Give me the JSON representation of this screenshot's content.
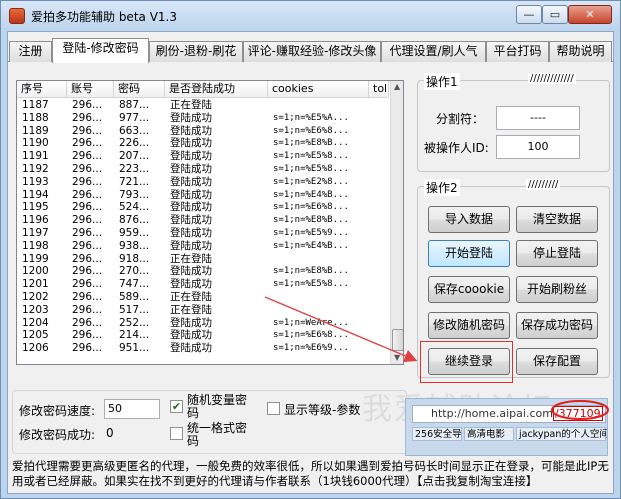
{
  "window": {
    "title": "爱拍多功能辅助 beta V1.3",
    "controls": {
      "minimize": "—",
      "maximize": "▭",
      "close": "✕"
    }
  },
  "tabs": [
    {
      "label": "注册"
    },
    {
      "label": "登陆-修改密码"
    },
    {
      "label": "刷份-退粉-刷花"
    },
    {
      "label": "评论-赚取经验-修改头像"
    },
    {
      "label": "代理设置/刷人气"
    },
    {
      "label": "平台打码"
    },
    {
      "label": "帮助说明"
    }
  ],
  "grid": {
    "columns": [
      "序号",
      "账号",
      "密码",
      "是否登陆成功",
      "cookies",
      "tol"
    ],
    "rows": [
      {
        "id": "1187",
        "acct": "296...",
        "pwd": "887...",
        "status": "正在登陆",
        "cookie": ""
      },
      {
        "id": "1188",
        "acct": "296...",
        "pwd": "977...",
        "status": "登陆成功",
        "cookie": "s=1;n=%E5%A..."
      },
      {
        "id": "1189",
        "acct": "296...",
        "pwd": "663...",
        "status": "登陆成功",
        "cookie": "s=1;n=%E6%8..."
      },
      {
        "id": "1190",
        "acct": "296...",
        "pwd": "226...",
        "status": "登陆成功",
        "cookie": "s=1;n=%E8%B..."
      },
      {
        "id": "1191",
        "acct": "296...",
        "pwd": "207...",
        "status": "登陆成功",
        "cookie": "s=1;n=%E5%8..."
      },
      {
        "id": "1192",
        "acct": "296...",
        "pwd": "223...",
        "status": "登陆成功",
        "cookie": "s=1;n=%E5%8..."
      },
      {
        "id": "1193",
        "acct": "296...",
        "pwd": "721...",
        "status": "登陆成功",
        "cookie": "s=1;n=%E2%8..."
      },
      {
        "id": "1194",
        "acct": "296...",
        "pwd": "793...",
        "status": "登陆成功",
        "cookie": "s=1;n=%E4%B..."
      },
      {
        "id": "1195",
        "acct": "296...",
        "pwd": "524...",
        "status": "登陆成功",
        "cookie": "s=1;n=%E6%8..."
      },
      {
        "id": "1196",
        "acct": "296...",
        "pwd": "876...",
        "status": "登陆成功",
        "cookie": "s=1;n=%E8%B..."
      },
      {
        "id": "1197",
        "acct": "296...",
        "pwd": "959...",
        "status": "登陆成功",
        "cookie": "s=1;n=%E5%9..."
      },
      {
        "id": "1198",
        "acct": "296...",
        "pwd": "938...",
        "status": "登陆成功",
        "cookie": "s=1;n=%E4%B..."
      },
      {
        "id": "1199",
        "acct": "296...",
        "pwd": "918...",
        "status": "正在登陆",
        "cookie": ""
      },
      {
        "id": "1200",
        "acct": "296...",
        "pwd": "270...",
        "status": "登陆成功",
        "cookie": "s=1;n=%E8%B..."
      },
      {
        "id": "1201",
        "acct": "296...",
        "pwd": "747...",
        "status": "登陆成功",
        "cookie": "s=1;n=%E5%8..."
      },
      {
        "id": "1202",
        "acct": "296...",
        "pwd": "589...",
        "status": "正在登陆",
        "cookie": ""
      },
      {
        "id": "1203",
        "acct": "296...",
        "pwd": "517...",
        "status": "正在登陆",
        "cookie": ""
      },
      {
        "id": "1204",
        "acct": "296...",
        "pwd": "252...",
        "status": "登陆成功",
        "cookie": "s=1;n=WeAre..."
      },
      {
        "id": "1205",
        "acct": "296...",
        "pwd": "214...",
        "status": "登陆成功",
        "cookie": "s=1;n=%E6%8..."
      },
      {
        "id": "1206",
        "acct": "296...",
        "pwd": "951...",
        "status": "登陆成功",
        "cookie": "s=1;n=%E6%9..."
      }
    ]
  },
  "op1": {
    "title": "操作1",
    "decor": "/////////////",
    "delimiter_label": "分割符：",
    "delimiter_value": "----",
    "operator_label": "被操作人ID:",
    "operator_value": "100"
  },
  "op2": {
    "title": "操作2",
    "decor": "/////////",
    "buttons": {
      "import": "导入数据",
      "clear": "清空数据",
      "start_login": "开始登陆",
      "stop_login": "停止登陆",
      "save_cookie": "保存coookie",
      "start_fans": "开始刷粉丝",
      "change_pwd": "修改随机密码",
      "save_pwd": "保存成功密码",
      "continue_login": "继续登录",
      "save_config": "保存配置"
    }
  },
  "bottom": {
    "speed_label": "修改密码速度:",
    "speed_value": "50",
    "success_label": "修改密码成功:",
    "success_value": "0",
    "random_var": "随机变量密码",
    "unified_fmt": "统一格式密码",
    "show_level": "显示等级-参数"
  },
  "notice": "爱拍代理需要更高级更匿名的代理，一般免费的效率很低，所以如果遇到爱拍号码长时间显示正在登录，可能是此IP无用或者已经屏蔽。如果实在找不到更好的代理请与作者联系（1块钱6000代理）【点击我复制淘宝连接】",
  "browser": {
    "url": "http://home.aipai.com",
    "url_highlight": "/377109",
    "tabs": [
      "256安全导",
      "高清电影",
      "jackypan的个人空间"
    ]
  },
  "watermark": "我爱辅助论坛"
}
